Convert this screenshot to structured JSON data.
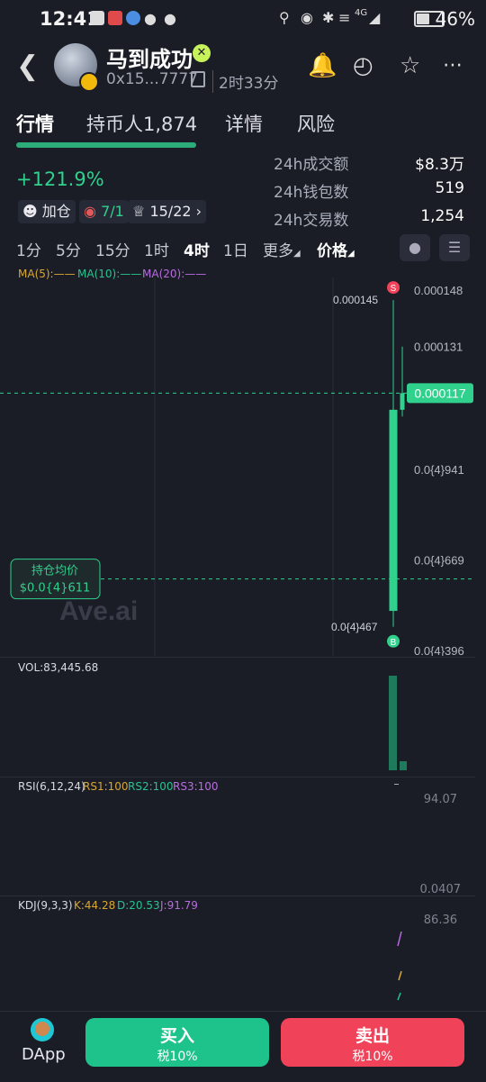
{
  "status_bar": {
    "time": "12:41",
    "battery": "46%",
    "network": "4G"
  },
  "header": {
    "title": "马到成功",
    "address": "0x15...7777",
    "age": "2时33分"
  },
  "tabs": [
    "行情",
    "持币人1,874",
    "详情",
    "风险"
  ],
  "token": {
    "change": "+121.9%",
    "chips": [
      "加仓",
      "7/1",
      "15/22"
    ]
  },
  "stats": [
    {
      "label": "24h成交额",
      "value": "$8.3万"
    },
    {
      "label": "24h钱包数",
      "value": "519"
    },
    {
      "label": "24h交易数",
      "value": "1,254"
    }
  ],
  "timeframes": [
    "1分",
    "5分",
    "15分",
    "1时",
    "4时",
    "1日",
    "更多",
    "价格"
  ],
  "active_timeframe": "4时",
  "ma": {
    "ma5": "MA(5):——",
    "ma10": "MA(10):——",
    "ma20": "MA(20):——"
  },
  "chart_data": {
    "type": "candlestick",
    "axis_ticks": [
      "0.000148",
      "0.000131",
      "0.0{4}941",
      "0.0{4}669",
      "0.0{4}396"
    ],
    "axis_tick_values": [
      0.000148,
      0.000131,
      9.41e-05,
      6.69e-05,
      3.96e-05
    ],
    "current_price": "0.000117",
    "current_price_value": 0.000117,
    "high_label": "0.000145",
    "high_value": 0.000145,
    "low_label": "0.0{4}467",
    "low_value": 4.67e-05,
    "avg_cost_label": "持仓均价",
    "avg_cost": "$0.0{4}611",
    "avg_cost_value": 6.11e-05,
    "sell_marker": "S",
    "buy_marker": "B",
    "watermark": "Ave.ai",
    "candles": [
      {
        "open": 5.15e-05,
        "close": 0.000112,
        "high": 0.000145,
        "low": 4.67e-05
      },
      {
        "open": 0.000112,
        "close": 0.000117,
        "high": 0.000131,
        "low": 0.00011
      }
    ]
  },
  "volume": {
    "label": "VOL:83,445.68",
    "bars": [
      83445.68,
      8000
    ]
  },
  "rsi": {
    "label": "RSI(6,12,24)",
    "rs1": "RS1:100",
    "rs2": "RS2:100",
    "rs3": "RS3:100",
    "ticks": [
      "94.07",
      "0.0407"
    ]
  },
  "kdj": {
    "label": "KDJ(9,3,3)",
    "k": "K:44.28",
    "d": "D:20.53",
    "j": "J:91.79",
    "tick": "86.36"
  },
  "bottom_bar": {
    "dapp": "DApp",
    "buy": "买入",
    "buy_tax": "税10%",
    "sell": "卖出",
    "sell_tax": "税10%"
  },
  "colors": {
    "up": "#2fd18d",
    "down": "#f0435a",
    "ma5": "#d9a733",
    "ma10": "#27c491",
    "ma20": "#b86ce0"
  }
}
